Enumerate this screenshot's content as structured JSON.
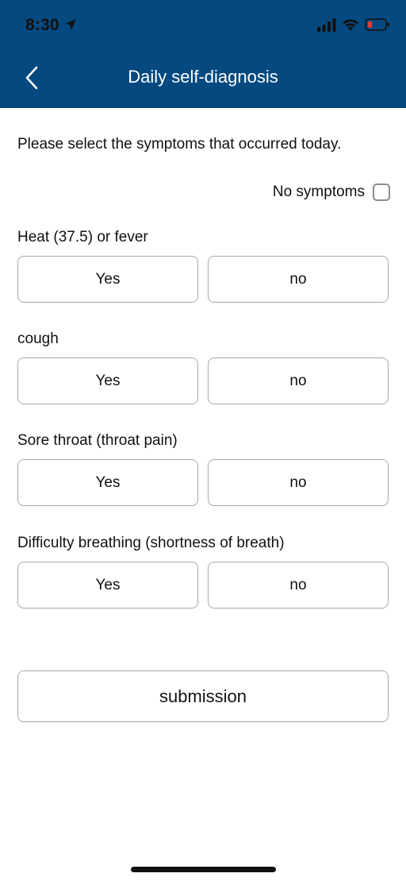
{
  "status_bar": {
    "time": "8:30",
    "icons": [
      "location-arrow-icon",
      "cellular-signal-icon",
      "wifi-icon",
      "battery-low-icon"
    ],
    "battery_color": "#e53935"
  },
  "nav": {
    "title": "Daily self-diagnosis",
    "back_icon": "chevron-left-icon"
  },
  "colors": {
    "header": "#044a80",
    "button_border": "#a9a9a9"
  },
  "form": {
    "instruction": "Please select the symptoms that occurred today.",
    "no_symptoms_label": "No symptoms",
    "no_symptoms_checked": false,
    "questions": [
      {
        "label": "Heat (37.5) or fever",
        "yes_label": "Yes",
        "no_label": "no"
      },
      {
        "label": "cough",
        "yes_label": "Yes",
        "no_label": "no"
      },
      {
        "label": "Sore throat (throat pain)",
        "yes_label": "Yes",
        "no_label": "no"
      },
      {
        "label": "Difficulty breathing (shortness of breath)",
        "yes_label": "Yes",
        "no_label": "no"
      }
    ],
    "submit_label": "submission"
  }
}
